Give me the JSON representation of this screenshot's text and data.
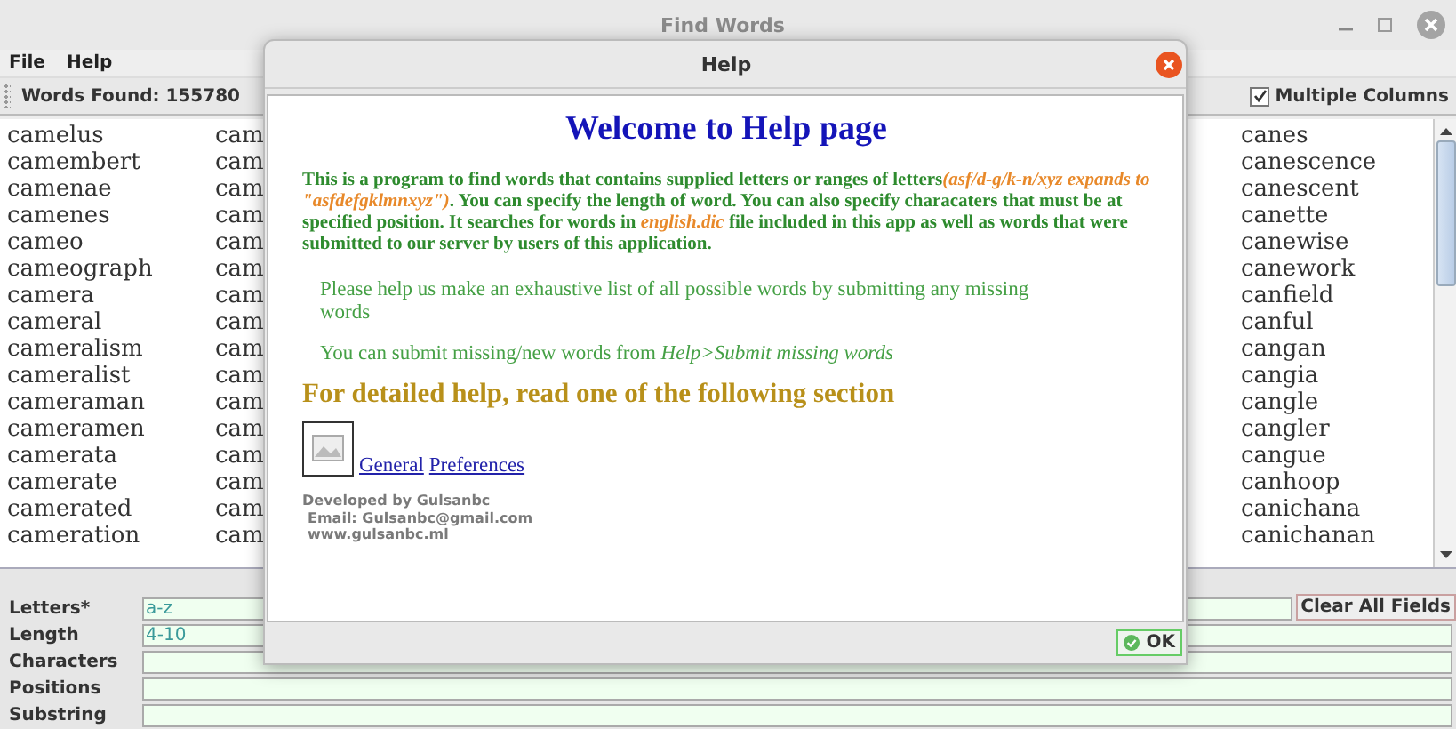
{
  "window": {
    "title": "Find Words"
  },
  "menu": [
    "File",
    "Help"
  ],
  "toolbar": {
    "words_found": "Words Found: 155780",
    "multiple_columns": {
      "label": "Multiple Columns",
      "checked": true
    }
  },
  "word_columns": [
    [
      "camelus",
      "camembert",
      "camenae",
      "camenes",
      "cameo",
      "cameograph",
      "camera",
      "cameral",
      "cameralism",
      "cameralist",
      "cameraman",
      "cameramen",
      "camerata",
      "camerate",
      "camerated",
      "cameration"
    ],
    [
      "cam",
      "cam",
      "cam",
      "cam",
      "cam",
      "cam",
      "cam",
      "cam",
      "cam",
      "cam",
      "cam",
      "cam",
      "cam",
      "cam",
      "cam",
      "cam"
    ],
    [
      "canes",
      "canescence",
      "canescent",
      "canette",
      "canewise",
      "canework",
      "canfield",
      "canful",
      "cangan",
      "cangia",
      "cangle",
      "cangler",
      "cangue",
      "canhoop",
      "canichana",
      "canichanan"
    ]
  ],
  "fields": [
    {
      "label": "Letters*",
      "value": "a-z"
    },
    {
      "label": "Length",
      "value": "4-10"
    },
    {
      "label": "Characters"
    },
    {
      "label": "Positions"
    },
    {
      "label": "Substring"
    }
  ],
  "clear_button": "Clear All Fields",
  "dialog": {
    "title": "Help",
    "heading": "Welcome to Help page",
    "intro": [
      {
        "text": "This is a program to find words that contains supplied letters or ranges of letters",
        "italic": false
      },
      {
        "text": "(asf/d-g/k-n/xyz expands to \"asfdefgklmnxyz\")",
        "italic": true
      },
      {
        "text": ". You can specify the length of word. You can also specify characaters that must be at specified position. It searches for words in ",
        "italic": false
      },
      {
        "text": "english.dic",
        "italic": true
      },
      {
        "text": " file included in this app as well as words that were submitted to our server by users of this application.",
        "italic": false
      }
    ],
    "note": "Please help us make an exhaustive list of all possible words by submitting any missing words",
    "submit": "You can submit missing/new words from *Help>Submit missing words*",
    "section_heading": "For detailed help, read one of the following section",
    "links": [
      "General",
      "Preferences"
    ],
    "footer": [
      "Developed by Gulsanbc",
      "Email: Gulsanbc@gmail.com",
      "www.gulsanbc.ml"
    ],
    "ok_button": "OK"
  }
}
